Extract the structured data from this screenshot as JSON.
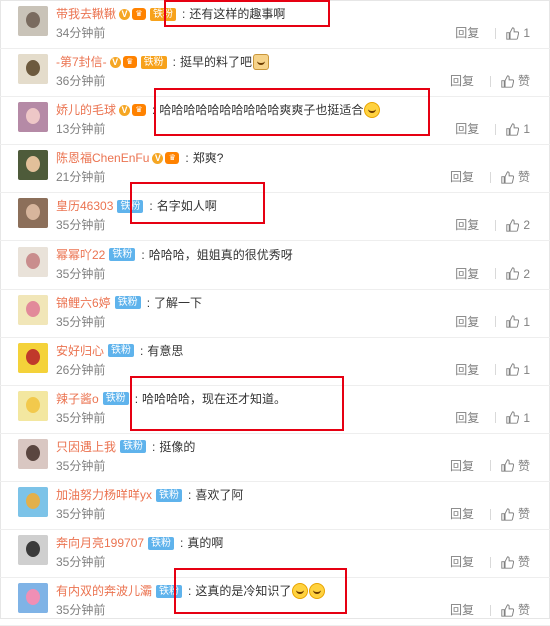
{
  "colors": {
    "username": "#eb7350",
    "time": "#808080",
    "highlight": "#e60012",
    "fan_gold": "#f7a21b",
    "fan_blue": "#5fb3ec"
  },
  "comments": [
    {
      "username": "带我去鞦鞦",
      "badges": [
        "v",
        "crown"
      ],
      "fan": "铁粉",
      "fan_style": "gold",
      "text": "还有这样的趣事啊",
      "emoji": 0,
      "time": "34分钟前",
      "reply": "回复",
      "likes": "1",
      "avatar": [
        "#c9c3b8",
        "#7a6b5f"
      ]
    },
    {
      "username": "-第7封信-",
      "badges": [
        "v",
        "crown"
      ],
      "fan": "铁粉",
      "fan_style": "gold",
      "text": "挺早的料了吧",
      "emoji": 1,
      "emoji_kind": "cat",
      "time": "36分钟前",
      "reply": "回复",
      "likes": "赞",
      "avatar": [
        "#e4dccb",
        "#6d5a3e"
      ]
    },
    {
      "username": "娇儿的毛球",
      "badges": [
        "v",
        "crown"
      ],
      "fan": "",
      "fan_style": "",
      "text": "哈哈哈哈哈哈哈哈哈哈爽爽子也挺适合",
      "emoji": 1,
      "time": "13分钟前",
      "reply": "回复",
      "likes": "1",
      "avatar": [
        "#b58aa6",
        "#eec7c7"
      ]
    },
    {
      "username": "陈恩福ChenEnFu",
      "badges": [
        "v",
        "crown"
      ],
      "fan": "",
      "fan_style": "",
      "text": "郑爽?",
      "emoji": 0,
      "time": "21分钟前",
      "reply": "回复",
      "likes": "赞",
      "avatar": [
        "#4e5b3a",
        "#e2c09a"
      ]
    },
    {
      "username": "皇历46303",
      "badges": [],
      "fan": "铁粉",
      "fan_style": "blue",
      "text": "名字如人啊",
      "emoji": 0,
      "time": "35分钟前",
      "reply": "回复",
      "likes": "2",
      "avatar": [
        "#8c6f5a",
        "#d7b59c"
      ]
    },
    {
      "username": "幂幂吖22",
      "badges": [],
      "fan": "铁粉",
      "fan_style": "blue",
      "text": "哈哈哈，姐姐真的很优秀呀",
      "emoji": 0,
      "time": "35分钟前",
      "reply": "回复",
      "likes": "2",
      "avatar": [
        "#e9e2d9",
        "#c98d8d"
      ]
    },
    {
      "username": "锦鲤六6婷",
      "badges": [],
      "fan": "铁粉",
      "fan_style": "blue",
      "text": "了解一下",
      "emoji": 0,
      "time": "35分钟前",
      "reply": "回复",
      "likes": "1",
      "avatar": [
        "#f1e6b8",
        "#e28a9a"
      ]
    },
    {
      "username": "安好归心",
      "badges": [],
      "fan": "铁粉",
      "fan_style": "blue",
      "text": "有意思",
      "emoji": 0,
      "time": "26分钟前",
      "reply": "回复",
      "likes": "1",
      "avatar": [
        "#f4d23a",
        "#c0392b"
      ]
    },
    {
      "username": "辣子酱o",
      "badges": [],
      "fan": "铁粉",
      "fan_style": "blue",
      "text": "哈哈哈哈，现在还才知道。",
      "emoji": 0,
      "time": "35分钟前",
      "reply": "回复",
      "likes": "1",
      "avatar": [
        "#f3e7a0",
        "#f2c94c"
      ]
    },
    {
      "username": "只因遇上我",
      "badges": [],
      "fan": "铁粉",
      "fan_style": "blue",
      "text": "挺像的",
      "emoji": 0,
      "time": "35分钟前",
      "reply": "回复",
      "likes": "赞",
      "avatar": [
        "#d9c7c2",
        "#5a4640"
      ]
    },
    {
      "username": "加油努力杨咩咩yx",
      "badges": [],
      "fan": "铁粉",
      "fan_style": "blue",
      "text": "喜欢了阿",
      "emoji": 0,
      "time": "35分钟前",
      "reply": "回复",
      "likes": "赞",
      "avatar": [
        "#7cc3e8",
        "#e3b04b"
      ]
    },
    {
      "username": "奔向月亮199707",
      "badges": [],
      "fan": "铁粉",
      "fan_style": "blue",
      "text": "真的啊",
      "emoji": 0,
      "time": "35分钟前",
      "reply": "回复",
      "likes": "赞",
      "avatar": [
        "#cfcfcf",
        "#3a3a3a"
      ]
    },
    {
      "username": "有内双的奔波儿灞",
      "badges": [],
      "fan": "铁粉",
      "fan_style": "blue",
      "text": "这真的是冷知识了",
      "emoji": 2,
      "time": "35分钟前",
      "reply": "回复",
      "likes": "赞",
      "avatar": [
        "#7fb3e6",
        "#f08fb5"
      ]
    }
  ]
}
